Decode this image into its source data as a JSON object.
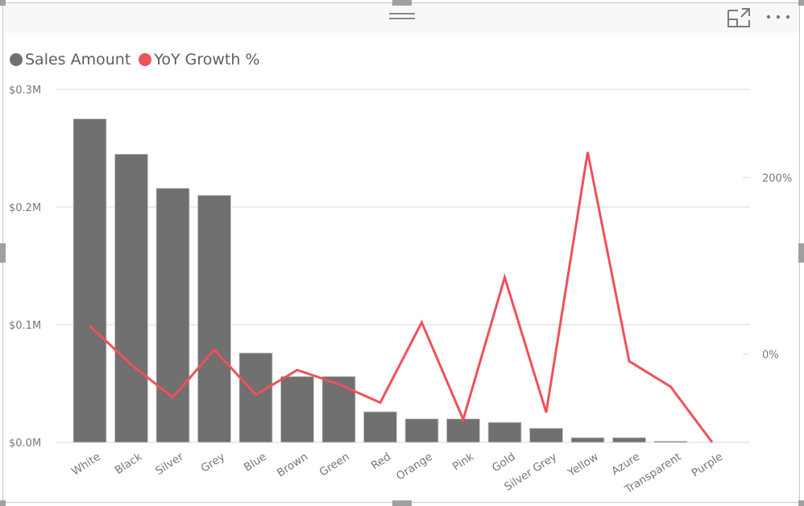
{
  "visual": {
    "header": {
      "drag_handle_icon": "drag-handle-icon",
      "focus_mode_icon": "focus-mode-icon",
      "more_options_icon": "more-options-icon"
    }
  },
  "chart_data": {
    "type": "bar+line",
    "title": "",
    "categories": [
      "White",
      "Black",
      "Silver",
      "Grey",
      "Blue",
      "Brown",
      "Green",
      "Red",
      "Orange",
      "Pink",
      "Gold",
      "Silver Grey",
      "Yellow",
      "Azure",
      "Transparent",
      "Purple"
    ],
    "legend": {
      "position": "top-left",
      "items": [
        {
          "name": "Sales Amount",
          "color": "#707070"
        },
        {
          "name": "YoY Growth %",
          "color": "#f0505a"
        }
      ]
    },
    "series": [
      {
        "name": "Sales Amount",
        "type": "bar",
        "axis": "left",
        "color": "#707070",
        "unit": "$M",
        "values": [
          0.275,
          0.245,
          0.216,
          0.21,
          0.076,
          0.056,
          0.056,
          0.026,
          0.02,
          0.02,
          0.017,
          0.012,
          0.004,
          0.004,
          0.001,
          0.0
        ]
      },
      {
        "name": "YoY Growth %",
        "type": "line",
        "axis": "right",
        "color": "#f0505a",
        "unit": "%",
        "values": [
          32,
          -12,
          -49,
          5,
          -46,
          -18,
          -34,
          -55,
          36,
          -74,
          87,
          -66,
          229,
          -8,
          -37,
          -100
        ]
      }
    ],
    "y_left": {
      "ticks": [
        "$0.0M",
        "$0.1M",
        "$0.2M",
        "$0.3M"
      ],
      "tick_values": [
        0,
        0.1,
        0.2,
        0.3
      ],
      "ylim": [
        0,
        0.3
      ]
    },
    "y_right": {
      "ticks": [
        "0%",
        "200%"
      ],
      "tick_values": [
        0,
        200
      ],
      "ylim": [
        -100,
        300
      ]
    },
    "grid": true,
    "xlabel": "",
    "ylabel": ""
  }
}
